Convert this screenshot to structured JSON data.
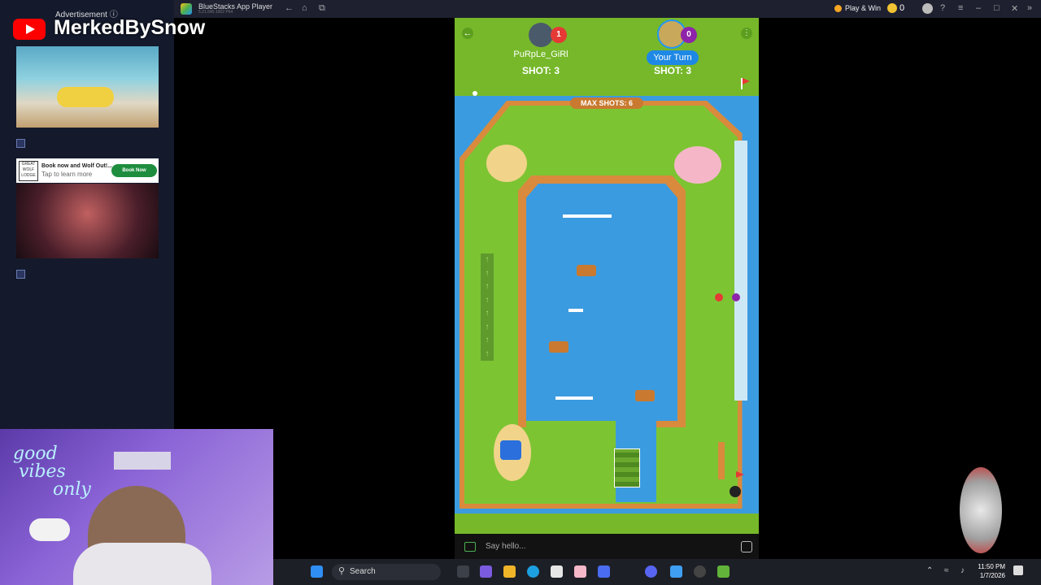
{
  "window": {
    "app_title": "BlueStacks App Player",
    "version": "5.21.640.1002 P64",
    "play_win_label": "Play & Win",
    "coins": "0"
  },
  "ad_panel": {
    "header": "Advertisement ⓘ",
    "wolf_ad_headline": "Book now and Wolf Out!...",
    "wolf_ad_sub": "Tap to learn more",
    "wolf_ad_logo": "GREAT WOLF LODGE",
    "wolf_ad_cta": "Book Now"
  },
  "stream": {
    "channel_name": "MerkedBySnow"
  },
  "game": {
    "player1_name": "PuRpLe_GiRl",
    "player1_badge": "1",
    "player1_shot": "SHOT: 3",
    "player2_label": "Your Turn",
    "player2_badge": "0",
    "player2_shot": "SHOT: 3",
    "max_shots": "MAX SHOTS: 6",
    "chat_placeholder": "Say hello..."
  },
  "taskbar": {
    "search_label": "Search",
    "time": "11:50 PM",
    "date": "1/7/2026"
  },
  "colors": {
    "grass": "#76b82a",
    "water": "#3b9be0",
    "brick": "#d98a3d",
    "badge_red": "#e53935",
    "badge_purple": "#8e24aa"
  }
}
